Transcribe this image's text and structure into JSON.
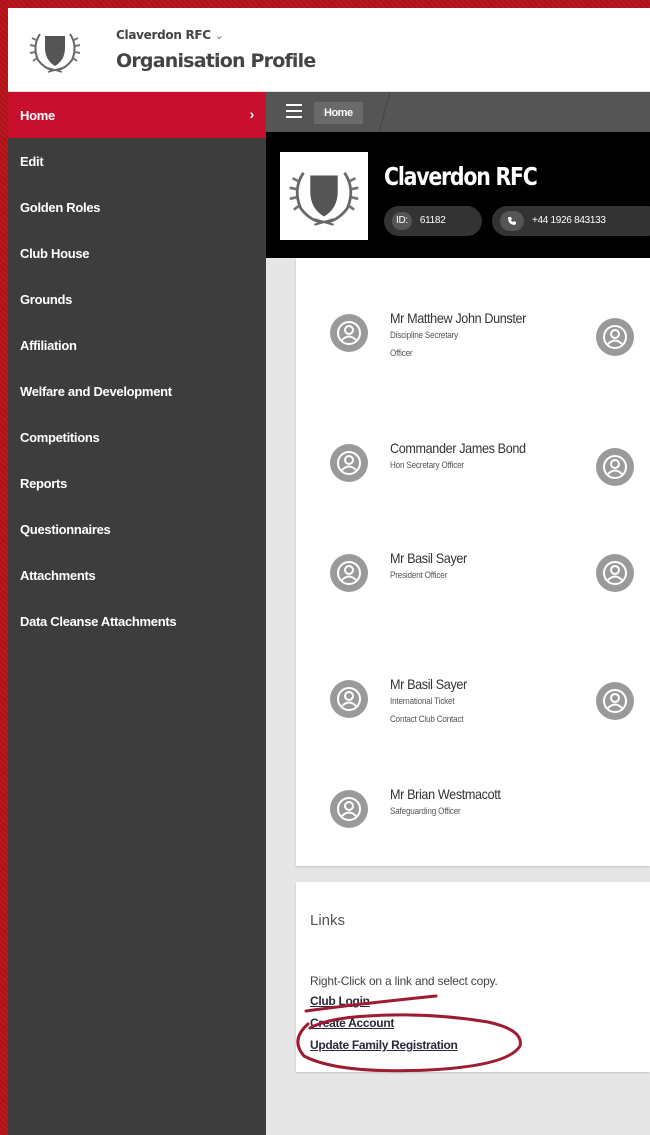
{
  "header": {
    "org_name": "Claverdon RFC",
    "org_chevron": "⌄",
    "profile_title": "Organisation Profile"
  },
  "sidebar": {
    "items": [
      {
        "label": "Home",
        "active": true,
        "arrow": "›"
      },
      {
        "label": "Edit"
      },
      {
        "label": "Golden Roles"
      },
      {
        "label": "Club House"
      },
      {
        "label": "Grounds"
      },
      {
        "label": "Affiliation"
      },
      {
        "label": "Welfare and Development"
      },
      {
        "label": "Competitions"
      },
      {
        "label": "Reports"
      },
      {
        "label": "Questionnaires"
      },
      {
        "label": "Attachments"
      },
      {
        "label": "Data Cleanse Attachments"
      }
    ]
  },
  "breadcrumb": {
    "home": "Home"
  },
  "club": {
    "title": "Claverdon RFC",
    "id_label": "ID:",
    "id_value": "61182",
    "phone": "+44 1926 843133"
  },
  "officers": [
    {
      "name": "Mr Matthew John Dunster",
      "roles": [
        "Discipline Secretary",
        "Officer"
      ]
    },
    {
      "name": "Commander James Bond",
      "roles": [
        "Hon Secretary Officer"
      ]
    },
    {
      "name": "Mr Basil Sayer",
      "roles": [
        "President Officer"
      ]
    },
    {
      "name": "Mr Basil Sayer",
      "roles": [
        "International Ticket",
        "Contact Club Contact"
      ]
    },
    {
      "name": "Mr Brian Westmacott",
      "roles": [
        "Safeguarding Officer"
      ]
    }
  ],
  "links": {
    "title": "Links",
    "note": "Right-Click on a link and select copy.",
    "items": [
      "Club Login",
      "Create Account",
      "Update Family Registration"
    ]
  },
  "colors": {
    "brand_red": "#c8102e",
    "sidebar_bg": "#3d3d3d",
    "annotation": "#9e1b32"
  }
}
